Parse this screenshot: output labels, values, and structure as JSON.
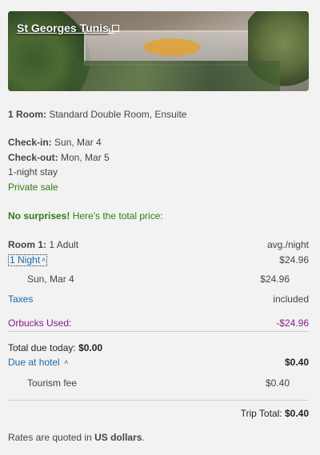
{
  "hotel": {
    "name": "St Georges Tunis"
  },
  "booking": {
    "room_label": "1 Room:",
    "room_value": "Standard Double Room, Ensuite",
    "checkin_label": "Check-in:",
    "checkin_value": "Sun, Mar 4",
    "checkout_label": "Check-out:",
    "checkout_value": "Mon, Mar 5",
    "stay": "1-night stay",
    "sale": "Private sale"
  },
  "notice": {
    "bold": "No surprises!",
    "rest": " Here's the total price:"
  },
  "pricing": {
    "room_label": "Room 1:",
    "room_guests": "1 Adult",
    "avg_label": "avg./night",
    "nights_link": "1 Night",
    "nights_total": "$24.96",
    "night_date": "Sun, Mar 4",
    "night_price": "$24.96",
    "taxes_label": "Taxes",
    "taxes_value": "included",
    "orbucks_label": "Orbucks Used:",
    "orbucks_value": "-$24.96",
    "due_today_label": "Total due today:",
    "due_today_value": "$0.00",
    "due_hotel_label": "Due at hotel",
    "due_hotel_value": "$0.40",
    "tourism_label": "Tourism fee",
    "tourism_value": "$0.40",
    "trip_total_label": "Trip Total:",
    "trip_total_value": "$0.40"
  },
  "footer": {
    "prefix": "Rates are quoted in ",
    "currency": "US dollars",
    "suffix": "."
  },
  "icons": {
    "external": "external-link-icon",
    "chevron": "chevron-up-double-icon"
  }
}
